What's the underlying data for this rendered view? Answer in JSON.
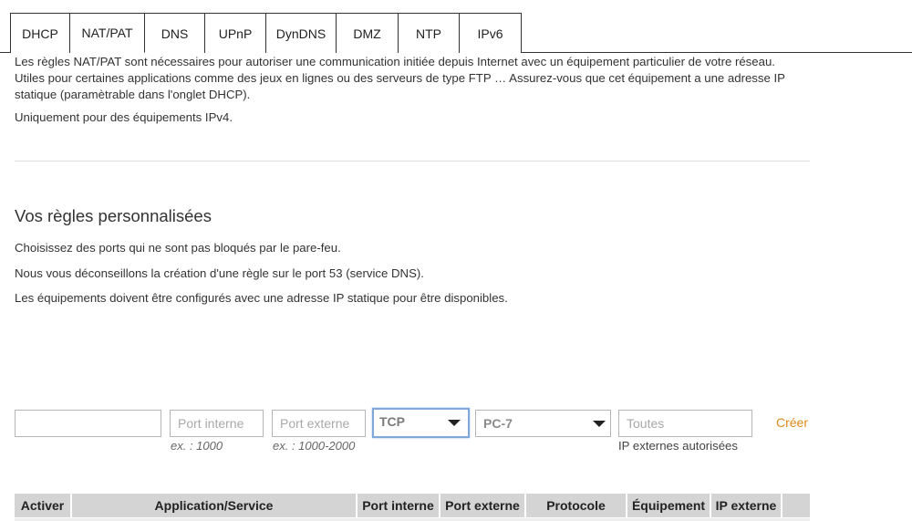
{
  "tabs": [
    {
      "label": "DHCP"
    },
    {
      "label": "NAT/PAT"
    },
    {
      "label": "DNS"
    },
    {
      "label": "UPnP"
    },
    {
      "label": "DynDNS"
    },
    {
      "label": "DMZ"
    },
    {
      "label": "NTP"
    },
    {
      "label": "IPv6"
    }
  ],
  "active_tab": "NAT/PAT",
  "intro": {
    "text": "Les règles NAT/PAT sont nécessaires pour autoriser une communication initiée depuis Internet avec un équipement particulier de votre réseau. Utiles pour certaines applications comme des jeux en lignes ou des serveurs de type FTP … Assurez-vous que cet équipement a une adresse IP statique (paramètrable dans l'onglet DHCP).",
    "ipv4_note": "Uniquement pour des équipements IPv4."
  },
  "custom_rules": {
    "title": "Vos règles personnalisées",
    "notes": [
      "Choisissez des ports qui ne sont pas bloqués par le pare-feu.",
      "Nous vous déconseillons la création d'une règle sur le port 53 (service DNS).",
      "Les équipements doivent être configurés avec une adresse IP statique pour être disponibles."
    ]
  },
  "form": {
    "app_name_value": "",
    "internal_port_placeholder": "Port interne",
    "internal_port_hint": "ex. : 1000",
    "external_port_placeholder": "Port externe",
    "external_port_hint": "ex. : 1000-2000",
    "protocol_value": "TCP",
    "device_value": "PC-7",
    "external_ip_placeholder": "Toutes",
    "external_ip_hint": "IP externes autorisées",
    "create_label": "Créer"
  },
  "table": {
    "headers": [
      "Activer",
      "Application/Service",
      "Port interne",
      "Port externe",
      "Protocole",
      "Équipement",
      "IP externe",
      ""
    ]
  },
  "colors": {
    "accent_link": "#e08a1a",
    "header_bg": "#d4d4d4",
    "focus_border": "#7da8d9"
  }
}
